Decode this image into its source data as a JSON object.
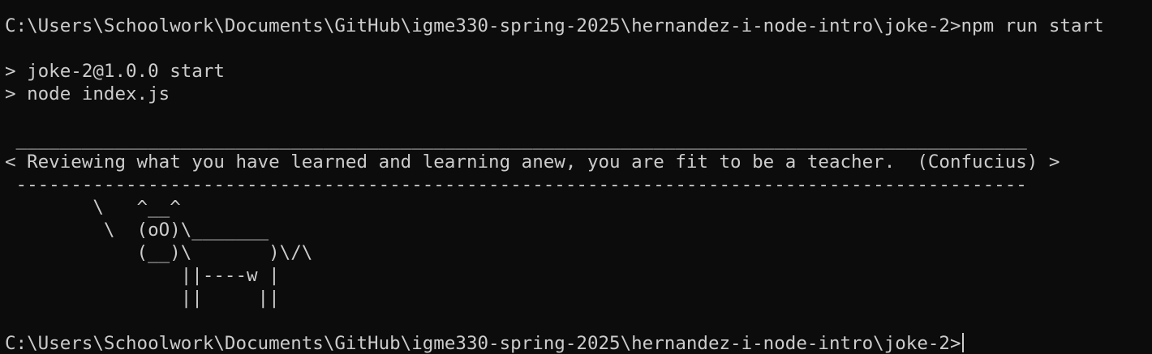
{
  "terminal": {
    "lines": [
      "C:\\Users\\Schoolwork\\Documents\\GitHub\\igme330-spring-2025\\hernandez-i-node-intro\\joke-2>npm run start",
      "",
      "> joke-2@1.0.0 start",
      "> node index.js",
      "",
      " ____________________________________________________________________________________________",
      "< Reviewing what you have learned and learning anew, you are fit to be a teacher.  (Confucius) >",
      " --------------------------------------------------------------------------------------------",
      "        \\   ^__^",
      "         \\  (oO)\\_______",
      "            (__)\\       )\\/\\",
      "                ||----w |",
      "                ||     ||",
      "",
      "C:\\Users\\Schoolwork\\Documents\\GitHub\\igme330-spring-2025\\hernandez-i-node-intro\\joke-2>"
    ]
  },
  "colors": {
    "background": "#0c0c0c",
    "foreground": "#cccccc"
  }
}
